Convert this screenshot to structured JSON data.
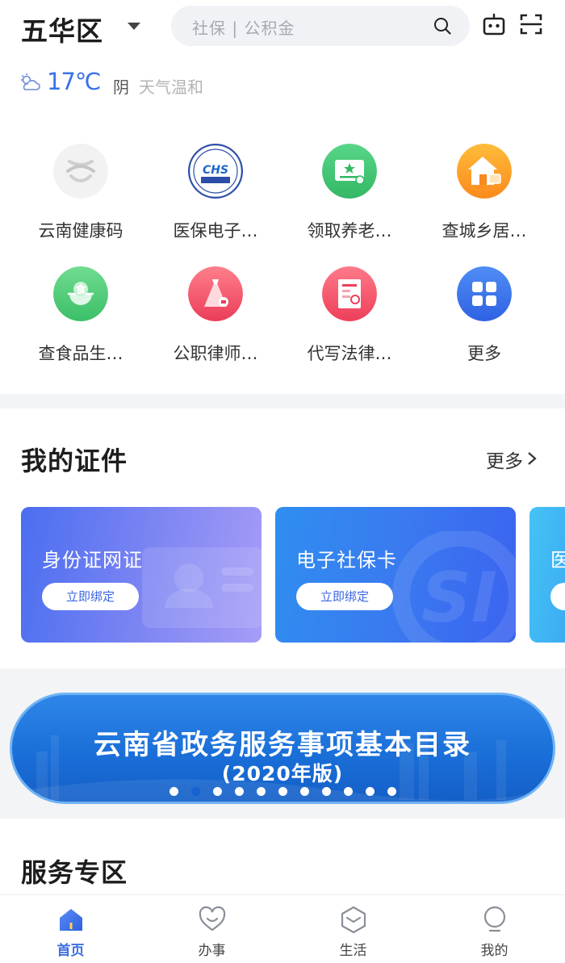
{
  "header": {
    "district": "五华区",
    "search_placeholder": "社保 | 公积金"
  },
  "weather": {
    "temperature": "17℃",
    "condition": "阴",
    "description": "天气温和"
  },
  "quick_services": [
    {
      "label": "云南健康码",
      "icon": "health-code-icon"
    },
    {
      "label": "医保电子…",
      "icon": "chs-medical-insurance-icon"
    },
    {
      "label": "领取养老…",
      "icon": "pension-card-icon"
    },
    {
      "label": "查城乡居…",
      "icon": "residence-house-icon"
    },
    {
      "label": "查食品生…",
      "icon": "food-icon"
    },
    {
      "label": "公职律师…",
      "icon": "lawyer-icon"
    },
    {
      "label": "代写法律…",
      "icon": "legal-document-icon"
    },
    {
      "label": "更多",
      "icon": "more-grid-icon"
    }
  ],
  "certificates": {
    "title": "我的证件",
    "more_label": "更多",
    "cards": [
      {
        "title": "身份证网证",
        "button": "立即绑定"
      },
      {
        "title": "电子社保卡",
        "button": "立即绑定"
      },
      {
        "title": "医",
        "button": ""
      }
    ]
  },
  "banner": {
    "line1": "云南省政务服务事项基本目录",
    "line2": "(2020年版)",
    "page_count": 11,
    "active_index": 1
  },
  "services": {
    "title": "服务专区"
  },
  "tabbar": [
    {
      "label": "首页",
      "icon": "home-icon",
      "active": true
    },
    {
      "label": "办事",
      "icon": "heart-smile-icon",
      "active": false
    },
    {
      "label": "生活",
      "icon": "cube-icon",
      "active": false
    },
    {
      "label": "我的",
      "icon": "person-icon",
      "active": false
    }
  ],
  "colors": {
    "accent": "#3a72e8",
    "id_card_gradient": [
      "#4a6ef0",
      "#a69df7"
    ],
    "social_card_gradient": [
      "#2f8ef0",
      "#3b63f0"
    ],
    "banner": "#1a6fd8"
  }
}
